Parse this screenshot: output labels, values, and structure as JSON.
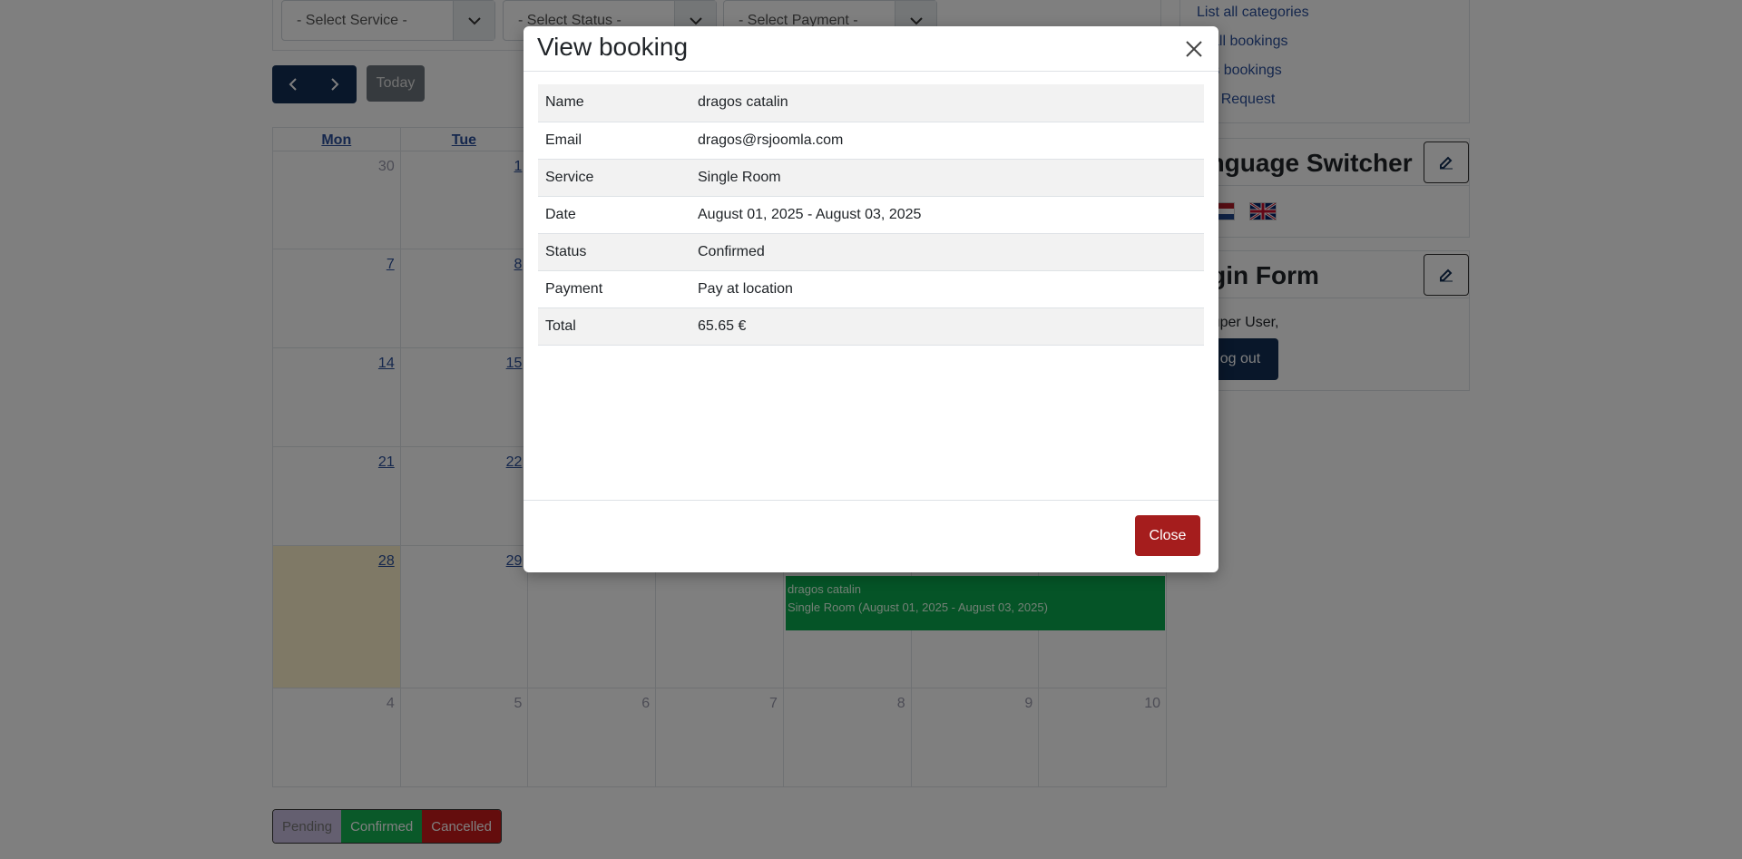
{
  "filters": {
    "service": "- Select Service -",
    "status": "- Select Status -",
    "payment": "- Select Payment -"
  },
  "toolbar": {
    "today": "Today"
  },
  "calendar": {
    "headers": [
      "Mon",
      "Tue",
      "",
      "",
      "",
      "",
      ""
    ],
    "weeks": [
      [
        "30",
        "1",
        "",
        "",
        "",
        "",
        ""
      ],
      [
        "7",
        "8",
        "",
        "",
        "",
        "",
        ""
      ],
      [
        "14",
        "15",
        "",
        "",
        "",
        "",
        ""
      ],
      [
        "21",
        "22",
        "",
        "",
        "",
        "",
        ""
      ],
      [
        "28",
        "29",
        "",
        "",
        "",
        "",
        ""
      ],
      [
        "4",
        "5",
        "6",
        "7",
        "8",
        "9",
        "10"
      ]
    ],
    "event": {
      "name": "dragos catalin",
      "detail": "Single Room (August 01, 2025 - August 03, 2025)"
    }
  },
  "legend": {
    "pending": "Pending",
    "confirmed": "Confirmed",
    "cancelled": "Cancelled"
  },
  "sidebar": {
    "links": [
      "List all categories",
      "w all bookings",
      "er's bookings",
      "ate Request"
    ],
    "language_title": "anguage Switcher",
    "login_title": "ogin Form",
    "greeting": "Super User,",
    "logout": "og out"
  },
  "modal": {
    "title": "View booking",
    "rows": [
      {
        "label": "Name",
        "value": "dragos catalin"
      },
      {
        "label": "Email",
        "value": "dragos@rsjoomla.com"
      },
      {
        "label": "Service",
        "value": "Single Room"
      },
      {
        "label": "Date",
        "value": "August 01, 2025 - August 03, 2025"
      },
      {
        "label": "Status",
        "value": "Confirmed"
      },
      {
        "label": "Payment",
        "value": "Pay at location"
      },
      {
        "label": "Total",
        "value": "65.65 €"
      }
    ],
    "close_button": "Close"
  },
  "colors": {
    "navy": "#132f54",
    "link": "#2a4f9a",
    "confirmed": "#14b352",
    "cancelled": "#c91a1a",
    "pending": "#c9bfe0",
    "close_btn": "#a51d1d"
  }
}
